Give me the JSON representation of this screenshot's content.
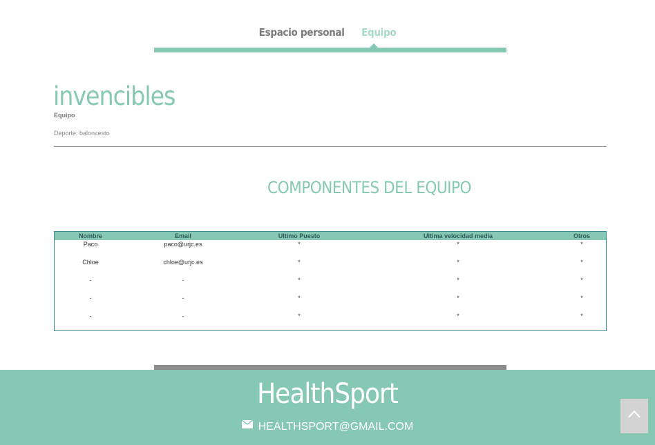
{
  "nav": {
    "tabs": [
      {
        "label": "Espacio personal"
      },
      {
        "label": "Equipo"
      }
    ]
  },
  "team": {
    "name": "invencibles",
    "type": "Equipo",
    "sport": "Deporte: baloncesto"
  },
  "members": {
    "title": "COMPONENTES DEL EQUIPO",
    "columns": [
      "Nombre",
      "Email",
      "Ultimo Puesto",
      "Ultima velocidad media",
      "Otros"
    ],
    "rows": [
      [
        "Paco",
        "paco@urjc.es",
        "*",
        "*",
        "*"
      ],
      [
        "Chloe",
        "chloe@urjc.es",
        "*",
        "*",
        "*"
      ],
      [
        "-",
        "-",
        "*",
        "*",
        "*"
      ],
      [
        "-",
        "-",
        "*",
        "*",
        "*"
      ],
      [
        "-",
        "-",
        "*",
        "*",
        "*"
      ]
    ]
  },
  "footer": {
    "brand": "HealthSport",
    "email": "HEALTHSPORT@GMAIL.COM",
    "email_icon": "envelope-icon",
    "back_to_top_icon": "chevron-up-icon"
  },
  "colors": {
    "accent": "#86c8b4",
    "accent_light": "#a8d8c8",
    "table_border": "#3a8a9a",
    "bar_gray": "#8c8c8c"
  }
}
